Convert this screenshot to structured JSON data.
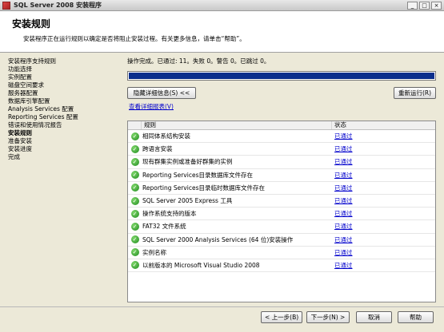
{
  "window": {
    "title": "SQL Server 2008 安装程序",
    "min": "_",
    "max": "□",
    "close": "×"
  },
  "header": {
    "title": "安装规则",
    "description": "安装程序正在运行规则以确定是否将阻止安装过程。有关更多信息，请单击“帮助”。"
  },
  "sidebar": {
    "items": [
      {
        "label": "安装程序支持规则"
      },
      {
        "label": "功能选择"
      },
      {
        "label": "实例配置"
      },
      {
        "label": "磁盘空间要求"
      },
      {
        "label": "服务器配置"
      },
      {
        "label": "数据库引擎配置"
      },
      {
        "label": "Analysis Services 配置"
      },
      {
        "label": "Reporting Services 配置"
      },
      {
        "label": "错误和使用情况报告"
      },
      {
        "label": "安装规则"
      },
      {
        "label": "准备安装"
      },
      {
        "label": "安装进度"
      },
      {
        "label": "完成"
      }
    ],
    "current_index": 9
  },
  "main": {
    "status": "操作完成。已通过: 11。失败 0。警告 0。已跳过 0。",
    "progress_fraction": 1.0,
    "hide_details_label": "隐藏详细信息(S) <<",
    "rerun_label": "重新运行(R)",
    "report_link": "查看详细报表(V)",
    "grid": {
      "col_rule": "规则",
      "col_status": "状态",
      "rows": [
        {
          "rule": "相同体系结构安装",
          "status": "已通过"
        },
        {
          "rule": "跨语言安装",
          "status": "已通过"
        },
        {
          "rule": "现有群集实例或准备好群集的实例",
          "status": "已通过"
        },
        {
          "rule": "Reporting Services目录数据库文件存在",
          "status": "已通过"
        },
        {
          "rule": "Reporting Services目录临时数据库文件存在",
          "status": "已通过"
        },
        {
          "rule": "SQL Server 2005 Express 工具",
          "status": "已通过"
        },
        {
          "rule": "操作系统支持的版本",
          "status": "已通过"
        },
        {
          "rule": "FAT32 文件系统",
          "status": "已通过"
        },
        {
          "rule": "SQL Server 2000 Analysis Services (64 位)安装操作",
          "status": "已通过"
        },
        {
          "rule": "实例名称",
          "status": "已通过"
        },
        {
          "rule": "以前版本的 Microsoft Visual Studio 2008",
          "status": "已通过"
        }
      ]
    }
  },
  "footer": {
    "back_label": "< 上一步(B)",
    "next_label": "下一步(N) >",
    "cancel_label": "取消",
    "help_label": "帮助"
  },
  "colors": {
    "progress_fill": "#0a2e8c",
    "check_green": "#1e8a1e",
    "link": "#0000cc"
  }
}
